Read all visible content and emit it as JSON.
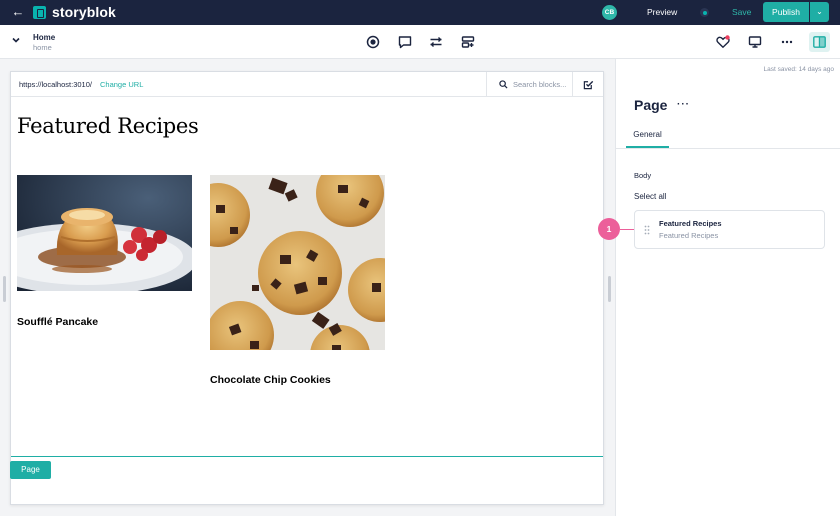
{
  "topbar": {
    "brand": "storyblok",
    "avatar_initials": "CB",
    "preview_label": "Preview",
    "save_label": "Save",
    "publish_label": "Publish"
  },
  "toolbar": {
    "story_title": "Home",
    "story_slug": "home",
    "icons": [
      "target-icon",
      "comment-icon",
      "sliders-icon",
      "blocks-icon",
      "heart-icon",
      "monitor-icon",
      "more-icon",
      "layout-toggle-icon"
    ]
  },
  "preview": {
    "url": "https://localhost:3010/",
    "change_url_label": "Change URL",
    "search_placeholder": "Search blocks...",
    "heading": "Featured Recipes",
    "recipes": [
      {
        "title": "Soufflé Pancake",
        "image": "souffle-pancake-image"
      },
      {
        "title": "Chocolate Chip Cookies",
        "image": "chocolate-chip-cookies-image"
      }
    ],
    "page_chip": "Page"
  },
  "sidebar": {
    "last_saved": "Last saved: 14 days ago",
    "title": "Page",
    "menu": "···",
    "tabs": [
      {
        "label": "General",
        "active": true
      }
    ],
    "field_label": "Body",
    "select_all": "Select all",
    "block": {
      "name": "Featured Recipes",
      "subtitle": "Featured Recipes"
    }
  },
  "annotation": {
    "number": "1"
  },
  "colors": {
    "navy": "#1b243f",
    "teal": "#1faea5",
    "annotation_pink": "#ec5f9a"
  }
}
